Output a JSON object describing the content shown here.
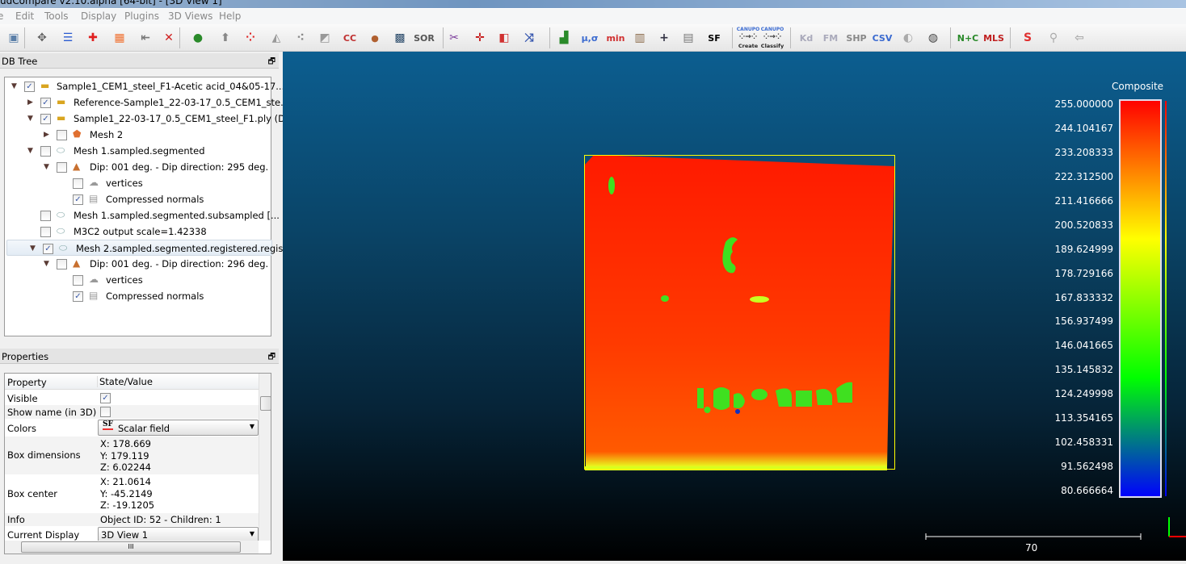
{
  "window": {
    "title": "udCompare v2.10.alpha [64-bit] - [3D View 1]"
  },
  "menu": [
    "Edit",
    "Tools",
    "Display",
    "Plugins",
    "3D Views",
    "Help"
  ],
  "toolbar": {
    "icons": [
      "save-icon",
      "pick-center-icon",
      "list-icon",
      "add-point-icon",
      "color-ramp-icon",
      "export-icon",
      "delete-icon",
      "align-icon",
      "normals-icon",
      "sample-points-icon",
      "mesh-icon",
      "subsample-icon",
      "delaunay-icon",
      "cloud-compare-icon",
      "primitive-icon",
      "checkerboard-icon",
      "sor-filter-icon",
      "scissors-icon",
      "translate-rotate-icon",
      "cross-section-icon",
      "segment-icon",
      "histogram-icon",
      "gaussian-icon",
      "min-max-icon",
      "scalar-field-delete-icon",
      "add-icon",
      "calculator-icon",
      "sf-icon",
      "canupo-create-icon",
      "canupo-classify-icon",
      "kd-tree-icon",
      "fast-marching-icon",
      "shp-icon",
      "csv-icon",
      "shade-icon",
      "sphere-icon",
      "normal-curvature-icon",
      "mls-icon",
      "profile-icon",
      "cloud-layer-icon",
      "transform-icon"
    ],
    "labels": {
      "sor": "SOR",
      "sf": "SF",
      "ccc": "CC",
      "canupo": "CANUPO",
      "create": "Create",
      "classify": "Classify",
      "kd": "Kd",
      "fm": "FM",
      "shp": "SHP",
      "csv": "CSV",
      "nc": "N+C",
      "mls": "MLS",
      "mu": "μ,σ",
      "min": "min",
      "max": "max"
    }
  },
  "db_tree": {
    "title": "DB Tree",
    "items": [
      {
        "label": "Sample1_CEM1_steel_F1-Acetic acid_04&05-17....",
        "checked": true,
        "icon": "folder-icon",
        "expanded": true
      },
      {
        "label": "Reference-Sample1_22-03-17_0.5_CEM1_ste...",
        "checked": true,
        "icon": "folder-icon",
        "expanded": false
      },
      {
        "label": "Sample1_22-03-17_0.5_CEM1_steel_F1.ply (D...",
        "checked": true,
        "icon": "folder-icon",
        "expanded": true
      },
      {
        "label": "Mesh 2",
        "checked": false,
        "icon": "mesh-icon",
        "expanded": false
      },
      {
        "label": "Mesh 1.sampled.segmented",
        "checked": false,
        "icon": "cloud-icon",
        "expanded": true
      },
      {
        "label": "Dip: 001 deg. - Dip direction: 295 deg.",
        "checked": false,
        "icon": "facet-icon",
        "expanded": true
      },
      {
        "label": "vertices",
        "checked": false,
        "icon": "locked-cloud-icon"
      },
      {
        "label": "Compressed normals",
        "checked": true,
        "icon": "normals-db-icon"
      },
      {
        "label": "Mesh 1.sampled.segmented.subsampled [...",
        "checked": false,
        "icon": "cloud-icon"
      },
      {
        "label": "M3C2 output scale=1.42338",
        "checked": false,
        "icon": "cloud-icon"
      },
      {
        "label": "Mesh 2.sampled.segmented.registered.regis...",
        "checked": true,
        "icon": "cloud-icon",
        "expanded": true,
        "selected": true
      },
      {
        "label": "Dip: 001 deg. - Dip direction: 296 deg.",
        "checked": false,
        "icon": "facet-icon",
        "expanded": true
      },
      {
        "label": "vertices",
        "checked": false,
        "icon": "locked-cloud-icon"
      },
      {
        "label": "Compressed normals",
        "checked": true,
        "icon": "normals-db-icon"
      }
    ]
  },
  "properties": {
    "title": "Properties",
    "col_property": "Property",
    "col_value": "State/Value",
    "visible_label": "Visible",
    "visible": true,
    "show_name_label": "Show name (in 3D)",
    "show_name": false,
    "colors_label": "Colors",
    "colors_value": "Scalar field",
    "sf_badge": "SF",
    "box_dim_label": "Box dimensions",
    "box_dim": [
      "X: 178.669",
      "Y: 179.119",
      "Z: 6.02244"
    ],
    "box_center_label": "Box center",
    "box_center": [
      "X: 21.0614",
      "Y: -45.2149",
      "Z: -19.1205"
    ],
    "info_label": "Info",
    "info_value": "Object ID: 52 - Children: 1",
    "display_label": "Current Display",
    "display_value": "3D View 1",
    "hscroll": "III"
  },
  "view3d": {
    "scale_title": "Composite",
    "scale_labels": [
      "255.000000",
      "244.104167",
      "233.208333",
      "222.312500",
      "211.416666",
      "200.520833",
      "189.624999",
      "178.729166",
      "167.833332",
      "156.937499",
      "146.041665",
      "135.145832",
      "124.249998",
      "113.354165",
      "102.458331",
      "91.562498",
      "80.666664"
    ],
    "scale_colors": [
      "#ff0000",
      "#ffff00",
      "#00ff00",
      "#0000ff"
    ],
    "scale_bar_label": "70",
    "bbox_color": "#ffff00"
  }
}
